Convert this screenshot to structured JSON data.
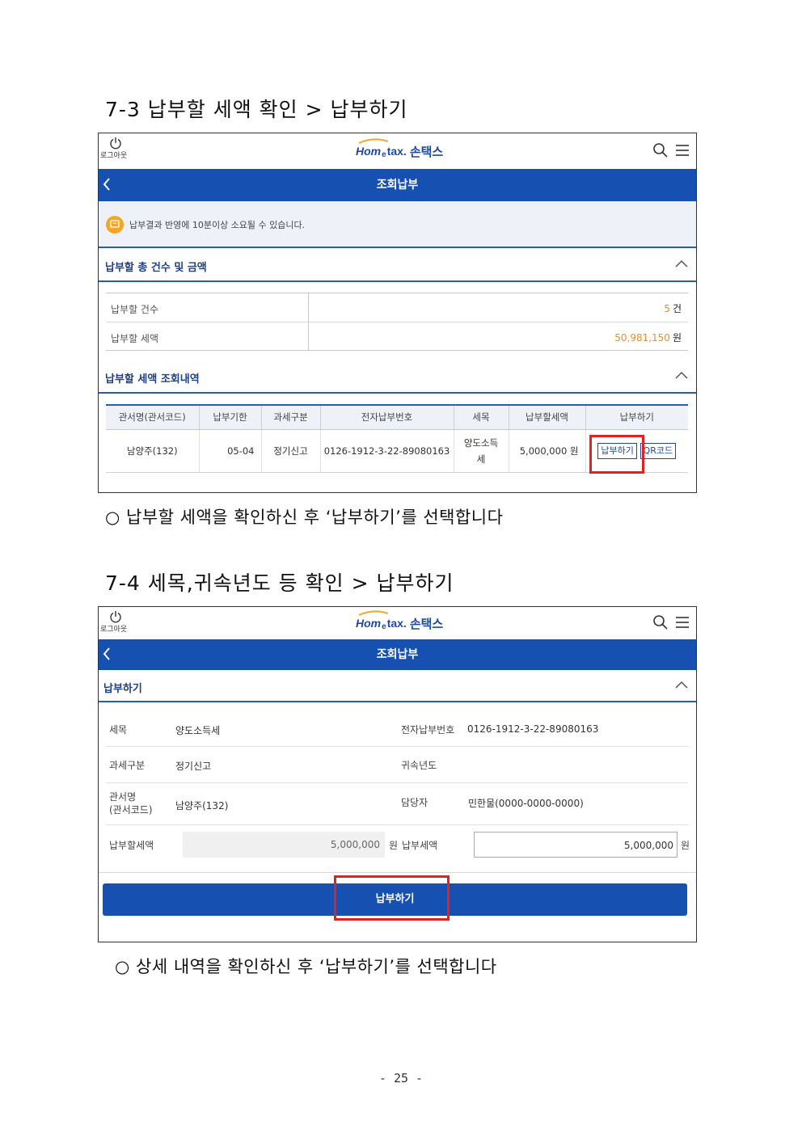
{
  "section1": {
    "heading": "7-3 납부할 세액 확인 > 납부하기",
    "caption": "○ 납부할 세액을 확인하신 후 ‘납부하기’를 선택합니다"
  },
  "section2": {
    "heading": "7-4 세목,귀속년도 등 확인 > 납부하기",
    "caption": "○ 상세 내역을 확인하신 후 ‘납부하기’를 선택합니다"
  },
  "app": {
    "logout_label": "로그아웃",
    "logo_home": "Hom",
    "logo_e": "e",
    "logo_tax": "tax.",
    "logo_son": "손택스",
    "page_title": "조회납부"
  },
  "screen1": {
    "notice": "납부결과 반영에 10분이상 소요될 수 있습니다.",
    "summary": {
      "title": "납부할 총 건수 및 금액",
      "count_label": "납부할 건수",
      "count_value": "5",
      "count_unit": "건",
      "amount_label": "납부할 세액",
      "amount_value": "50,981,150",
      "amount_unit": "원"
    },
    "list": {
      "title": "납부할 세액 조회내역",
      "headers": [
        "관서명(관서코드)",
        "납부기한",
        "과세구분",
        "전자납부번호",
        "세목",
        "납부할세액",
        "납부하기"
      ],
      "row": {
        "office": "남양주(132)",
        "due": "05-04",
        "type": "정기신고",
        "epay_no": "0126-1912-3-22-89080163",
        "tax_item_1": "양도소득",
        "tax_item_2": "세",
        "amount": "5,000,000 원",
        "pay_btn": "납부하기",
        "qr_btn": "QR코드"
      }
    }
  },
  "screen2": {
    "section_title": "납부하기",
    "tax_item_label": "세목",
    "tax_item_value": "양도소득세",
    "epay_label": "전자납부번호",
    "epay_value": "0126-1912-3-22-89080163",
    "type_label": "과세구분",
    "type_value": "정기신고",
    "year_label": "귀속년도",
    "office_label_1": "관서명",
    "office_label_2": "(관서코드)",
    "office_value": "남양주(132)",
    "manager_label": "담당자",
    "manager_value": "민한물(0000-0000-0000)",
    "due_amount_label": "납부할세액",
    "due_amount_value": "5,000,000",
    "won": "원",
    "pay_amount_label": "납부세액",
    "pay_amount_value": "5,000,000",
    "submit": "납부하기"
  },
  "page_number": "- 25 -"
}
